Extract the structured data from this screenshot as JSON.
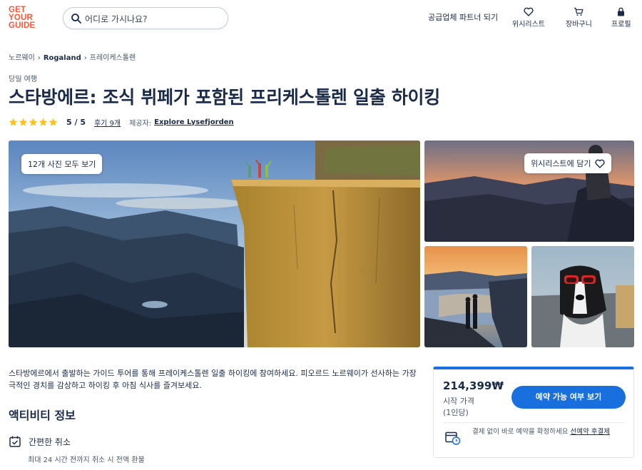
{
  "header": {
    "logo": [
      "GET",
      "YOUR",
      "GUIDE"
    ],
    "search_placeholder": "어디로 가시나요?",
    "partner_link": "공급업체 파트너 되기",
    "nav": {
      "wishlist": "위시리스트",
      "cart": "장바구니",
      "profile": "프로필"
    }
  },
  "breadcrumb": [
    "노르웨이",
    "Rogaland",
    "프레이케스톨렌"
  ],
  "category": "당일 여행",
  "title": "스타방에르: 조식 뷔페가 포함된 프리케스톨렌 일출 하이킹",
  "rating": {
    "stars": 5,
    "value": "5 / 5",
    "reviews": "후기 9개",
    "provider_label": "제공자:",
    "provider": "Explore Lysefjorden"
  },
  "gallery": {
    "view_all": "12개 사진 모두 보기",
    "wishlist_add": "위시리스트에 담기"
  },
  "description": "스타방에르에서 출발하는 가이드 투어를 통해 프레이케스톨렌 일출 하이킹에 참여하세요. 피오르드 노르웨이가 선사하는 가장 극적인 경치를 감상하고 하이킹 후 아침 식사를 즐겨보세요.",
  "activity_info": {
    "title": "액티비티 정보",
    "feature_label": "간편한 취소",
    "feature_sub": "최대 24 시간 전까지 취소 시 전액 환불"
  },
  "booking": {
    "price": "214,399₩",
    "price_from": "시작 가격",
    "per_person": "(1인당)",
    "button": "예약 가능 여부 보기",
    "pay_text": "결제 없이 바로 예약을 확정하세요",
    "pay_link": "선예약 후결제"
  },
  "colors": {
    "brand_orange": "#ff5533",
    "primary_blue": "#1a6fde",
    "text_navy": "#1a2b49",
    "star_yellow": "#ffc21a"
  }
}
